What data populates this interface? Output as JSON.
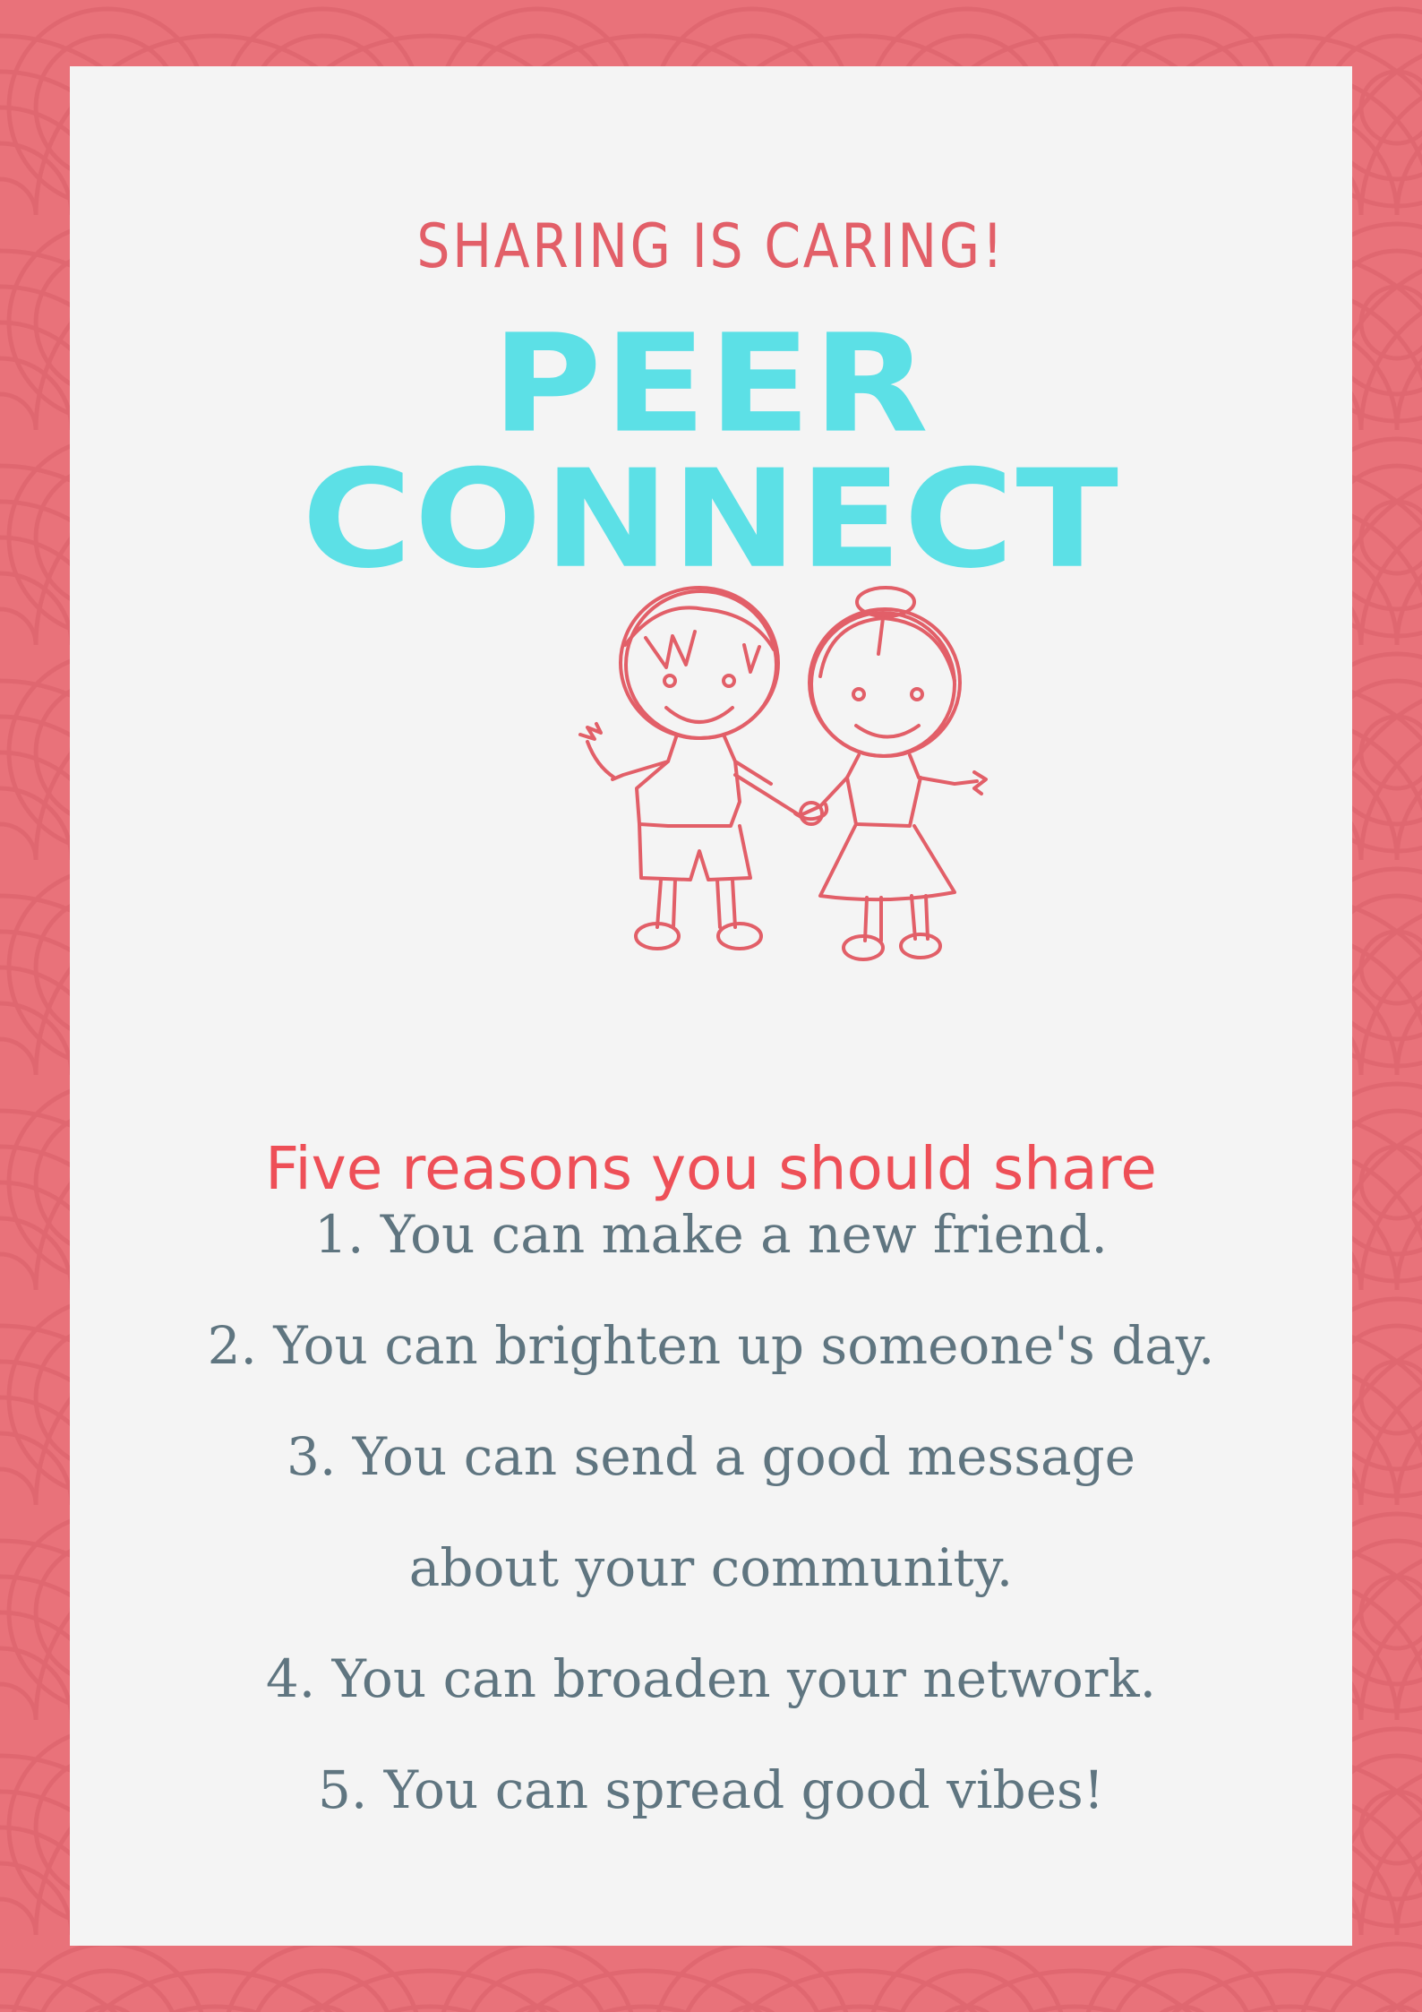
{
  "poster": {
    "tagline": "SHARING IS CARING!",
    "title": "PEER CONNECT",
    "illustration": "two-children-holding-hands-sketch",
    "subheading": "Five reasons you should share",
    "reasons": [
      "1. You can make a new friend.",
      "2. You can brighten up someone's day.",
      "3. You can send a good message about your community.",
      "4. You can broaden your network.",
      "5. You can spread good vibes!"
    ]
  },
  "colors": {
    "border": "#e9727a",
    "card": "#f4f4f4",
    "tagline": "#e25f68",
    "title": "#5ce0e6",
    "subheading": "#ee4f57",
    "body_text": "#5f7580",
    "sketch": "#e25f68"
  }
}
